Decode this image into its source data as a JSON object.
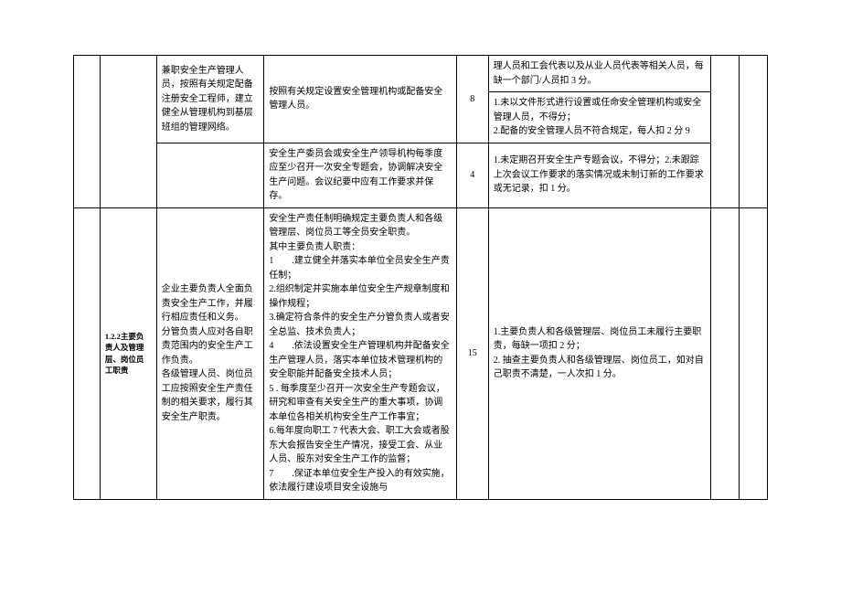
{
  "sectionLabel": "1.2.2主要负责人及管理层、岗位员工职责",
  "rows": {
    "r1": {
      "c3": "兼职安全生产管理人员，按照有关规定配备注册安全工程师，建立健全从管理机构到基层班组的管理网络。",
      "c4": "按照有关规定设置安全管理机构或配备安全管理人员。",
      "c5": "8",
      "c6a": "理人员和工会代表以及从业人员代表等相关人员，每缺一个部门/人员扣 3 分。",
      "c6b": "1.未以文件形式进行设置或任命安全管理机构或安全管理人员，不得分；\n2.配备的安全管理人员不符合规定，每人扣 2 分 9"
    },
    "r2": {
      "c4": "安全生产委员会或安全生产领导机构每季度应至少召开一次安全专题会，协调解决安全生产问题。会议纪要中应有工作要求并保存。",
      "c5": "4",
      "c6": "1.未定期召开安全生产专题会议，不得分；2.未跟踪上次会议工作要求的落实情况或未制订新的工作要求或无记录，扣 1 分。"
    },
    "r3": {
      "c3": "企业主要负责人全面负责安全生产工作，并履行相应责任和义务。\n分管负责人应对各自职责范围内的安全生产工作负责。\n各级管理人员、岗位员工应按照安全生产责任制的相关要求，履行其安全生产职责。",
      "c4": "安全生产责任制明确规定主要负责人和各级管理层、岗位员工等全员安全职责。\n其中主要负责人职责：\n1　　.建立健全并落实本单位全员安全生产责任制；\n2.组织制定并实施本单位安全生产规章制度和操作规程；\n3.确定符合条件的安全生产分管负责人或者安全总监、技术负责人；\n4　　.依法设置安全生产管理机构并配备安全生产管理人员，落实本单位技术管理机构的安全职能并配备安全技术人员；\n5 . 每季度至少召开一次安全生产专题会议，研究和审查有关安全生产的重大事项，协调本单位各相关机构安全生产工作事宜；\n6.每年度向职工 7 代表大会、职工大会或者股东大会报告安全生产情况，接受工会、从业人员、股东对安全生产工作的监督；\n7　　.保证本单位安全生产投入的有效实施，依法履行建设项目安全设施与",
      "c5": "15",
      "c6": "1.主要负责人和各级管理层、岗位员工未履行主要职责，每缺一项扣 2 分；\n2. 抽查主要负责人和各级管理层、岗位员工，如对自己职责不清楚，一人次扣 1 分。"
    }
  }
}
